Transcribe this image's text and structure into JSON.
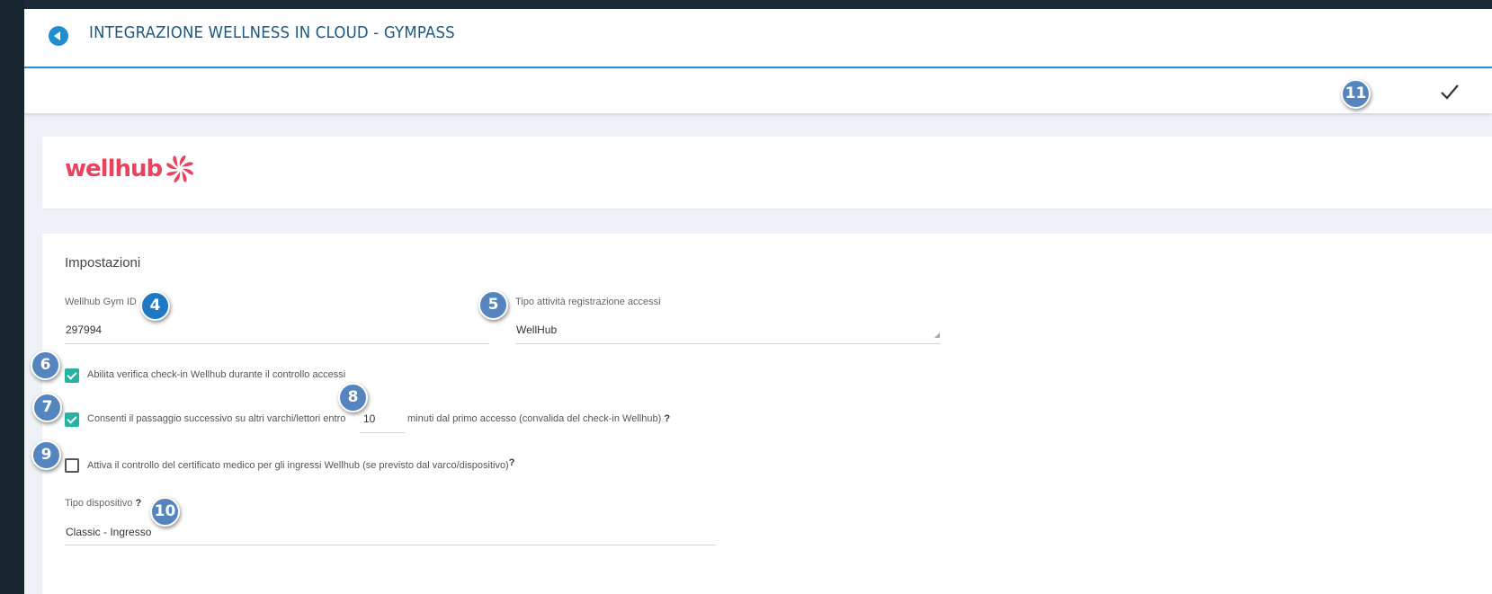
{
  "header": {
    "title": "INTEGRAZIONE WELLNESS IN CLOUD - GYMPASS",
    "back_icon": "back-arrow-icon"
  },
  "toolbar": {
    "save_icon": "checkmark-icon"
  },
  "logo": {
    "text": "wellhub",
    "color": "#e8435f"
  },
  "settings": {
    "section_title": "Impostazioni",
    "gym_id": {
      "label": "Wellhub Gym ID",
      "value": "297994"
    },
    "activity_type": {
      "label": "Tipo attività registrazione accessi",
      "value": "WellHub"
    },
    "checkin_verify": {
      "label": "Abilita verifica check-in Wellhub durante il controllo accessi",
      "checked": true
    },
    "subsequent_pass": {
      "label_before": "Consenti il passaggio successivo su altri varchi/lettori entro",
      "minutes": "10",
      "label_after": "minuti dal primo accesso (convalida del check-in Wellhub)",
      "help": "?",
      "checked": true
    },
    "medical_cert": {
      "label": "Attiva il controllo del certificato medico per gli ingressi Wellhub (se previsto dal varco/dispositivo)",
      "help": "?",
      "checked": false
    },
    "device_type": {
      "label": "Tipo dispositivo",
      "help": "?",
      "value": "Classic - Ingresso"
    }
  },
  "badges": [
    "4",
    "5",
    "6",
    "7",
    "8",
    "9",
    "10",
    "11"
  ],
  "colors": {
    "accent": "#1e8fd0",
    "checkbox": "#26b3a2",
    "badge": "#5585be",
    "sidebar": "#18262f"
  }
}
